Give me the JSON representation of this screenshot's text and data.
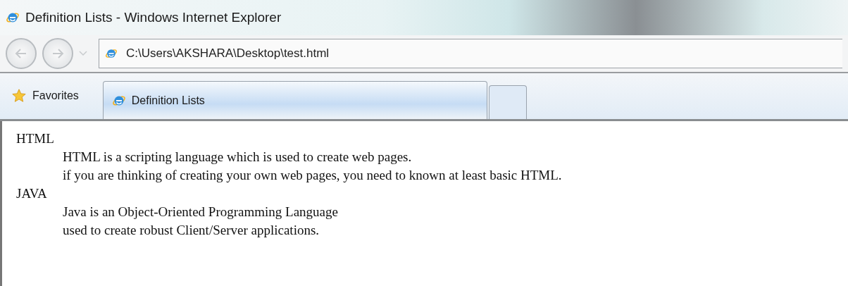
{
  "window": {
    "title": "Definition Lists - Windows Internet Explorer"
  },
  "address_bar": {
    "url": "C:\\Users\\AKSHARA\\Desktop\\test.html"
  },
  "favorites": {
    "label": "Favorites"
  },
  "tabs": [
    {
      "label": "Definition Lists",
      "selected": true
    }
  ],
  "definitions": [
    {
      "term": "HTML",
      "descriptions": [
        "HTML is a scripting language which is used to create web pages.",
        "if you are thinking of creating your own web pages, you need to known at least basic HTML."
      ]
    },
    {
      "term": "JAVA",
      "descriptions": [
        "Java is an Object-Oriented Programming Language",
        "used to create robust Client/Server applications."
      ]
    }
  ]
}
